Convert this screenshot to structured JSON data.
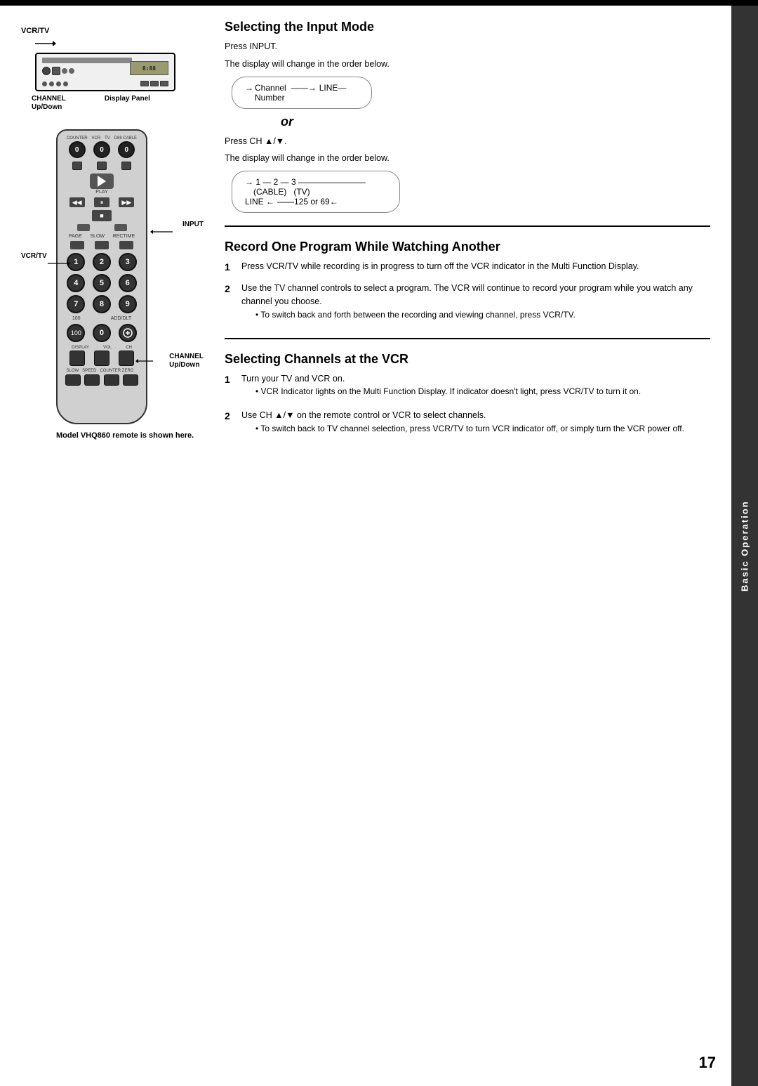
{
  "page": {
    "top_bar_color": "#000",
    "sidebar_label": "Basic Operation",
    "page_number": "17"
  },
  "left_column": {
    "vcr_label": "VCR/TV",
    "channel_updown": "CHANNEL\nUp/Down",
    "display_panel": "Display Panel",
    "remote_labels": {
      "vcrtv": "VCR/TV",
      "input": "INPUT",
      "channel_updown": "CHANNEL\nUp/Down"
    },
    "model_note": "Model VHQ860 remote is shown here.",
    "remote_buttons": {
      "top_row": [
        "0",
        "0",
        "0"
      ],
      "numpad": [
        "1",
        "2",
        "3",
        "4",
        "5",
        "6",
        "7",
        "8",
        "9",
        "100",
        "0",
        "ADD/DLT"
      ]
    }
  },
  "section1": {
    "title": "Selecting the Input Mode",
    "press_input": "Press INPUT.",
    "desc1": "The display will change in the order below.",
    "diagram1": {
      "arrow1": "→",
      "channel": "Channel",
      "number": "Number",
      "arrow2": "→",
      "line": "LINE"
    },
    "or_text": "or",
    "press_ch": "Press CH ▲/▼.",
    "desc2": "The display will change in the order below.",
    "diagram2": {
      "seq": "→ 1 — 2 — 3 —",
      "cable": "(CABLE)",
      "tv": "(TV)",
      "line_arrow": "LINE ←",
      "nums": "——125  or  69←"
    }
  },
  "section2": {
    "title": "Record One Program While Watching Another",
    "step1_num": "1",
    "step1_text": "Press VCR/TV while recording is in progress to turn off the VCR indicator in the Multi Function Display.",
    "step2_num": "2",
    "step2_text": "Use the TV channel controls to select a program. The VCR will continue to record your program while you watch any channel you choose.",
    "step2_bullet": "To switch back and forth between the recording and viewing channel, press VCR/TV."
  },
  "section3": {
    "title": "Selecting Channels at the VCR",
    "step1_num": "1",
    "step1_text": "Turn your TV and VCR on.",
    "step1_bullet": "VCR Indicator lights on the Multi Function Display. If indicator doesn't light, press VCR/TV to turn it on.",
    "step2_num": "2",
    "step2_text": "Use CH ▲/▼ on the remote control or VCR to select channels.",
    "step2_bullet": "To switch back to TV channel selection, press VCR/TV to turn VCR indicator off, or simply turn the VCR power off."
  }
}
